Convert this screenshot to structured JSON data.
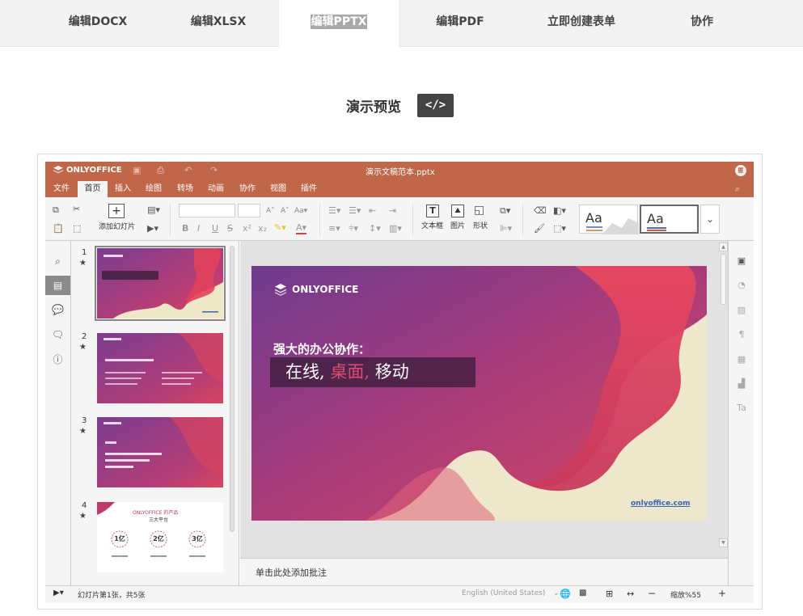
{
  "nav": {
    "tabs": [
      {
        "label": "编辑DOCX",
        "active": false
      },
      {
        "label": "编辑XLSX",
        "active": false
      },
      {
        "label": "编辑PPTX",
        "active": true
      },
      {
        "label": "编辑PDF",
        "active": false
      },
      {
        "label": "立即创建表单",
        "active": false
      },
      {
        "label": "协作",
        "active": false
      }
    ]
  },
  "preview": {
    "title": "演示预览",
    "code_label": "</>"
  },
  "editor": {
    "brand": "ONLYOFFICE",
    "doc_title": "演示文稿范本.pptx",
    "menu": [
      "文件",
      "首页",
      "插入",
      "绘图",
      "转场",
      "动画",
      "协作",
      "视图",
      "插件"
    ],
    "active_menu": "首页",
    "toolbar": {
      "add_slide_label": "添加幻灯片",
      "textbox_label": "文本框",
      "image_label": "图片",
      "shape_label": "形状",
      "theme1_label": "Aa",
      "theme2_label": "Aa"
    },
    "slides": [
      {
        "num": "1"
      },
      {
        "num": "2"
      },
      {
        "num": "3"
      },
      {
        "num": "4"
      }
    ],
    "thumb4": {
      "title": "ONLYOFFICE 的产品",
      "subtitle": "三大平台",
      "circles": [
        "1亿",
        "2亿",
        "3亿"
      ]
    },
    "main_slide": {
      "brand": "ONLYOFFICE",
      "heading": "强大的办公协作：",
      "line_a": "在线,",
      "line_b": "桌面,",
      "line_c": "移动",
      "link": "onlyoffice.com"
    },
    "notes_placeholder": "单击此处添加批注",
    "status": {
      "slide_info": "幻灯片第1张，共5张",
      "language": "English (United States)",
      "zoom": "缩放%55"
    },
    "colors": {
      "header": "#c0674a",
      "accent_pink": "#e04b72",
      "purple": "#6e3b8e"
    }
  }
}
